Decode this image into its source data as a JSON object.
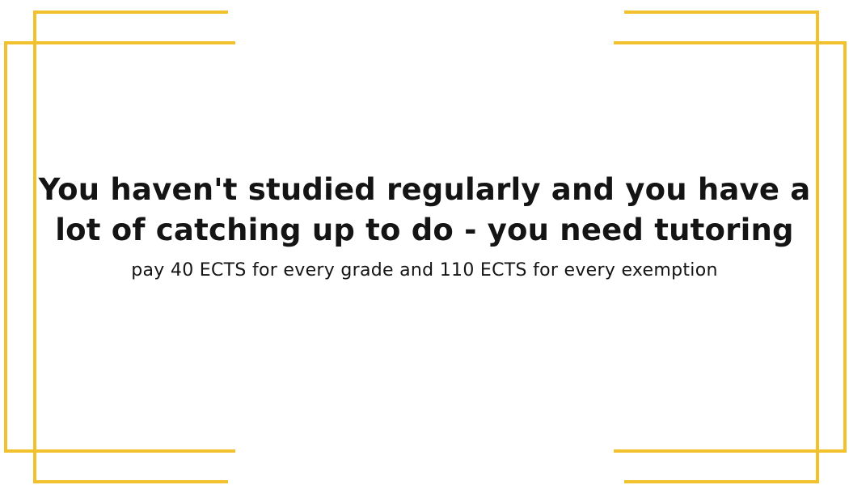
{
  "card": {
    "headline_line1": "You haven't studied regularly and you have a",
    "headline_line2": "lot of catching up to do - you need tutoring",
    "subline": "pay 40 ECTS for every grade and 110 ECTS for every exemption"
  },
  "colors": {
    "frame": "#F2C12E",
    "text": "#141414",
    "background": "#FFFFFF"
  }
}
